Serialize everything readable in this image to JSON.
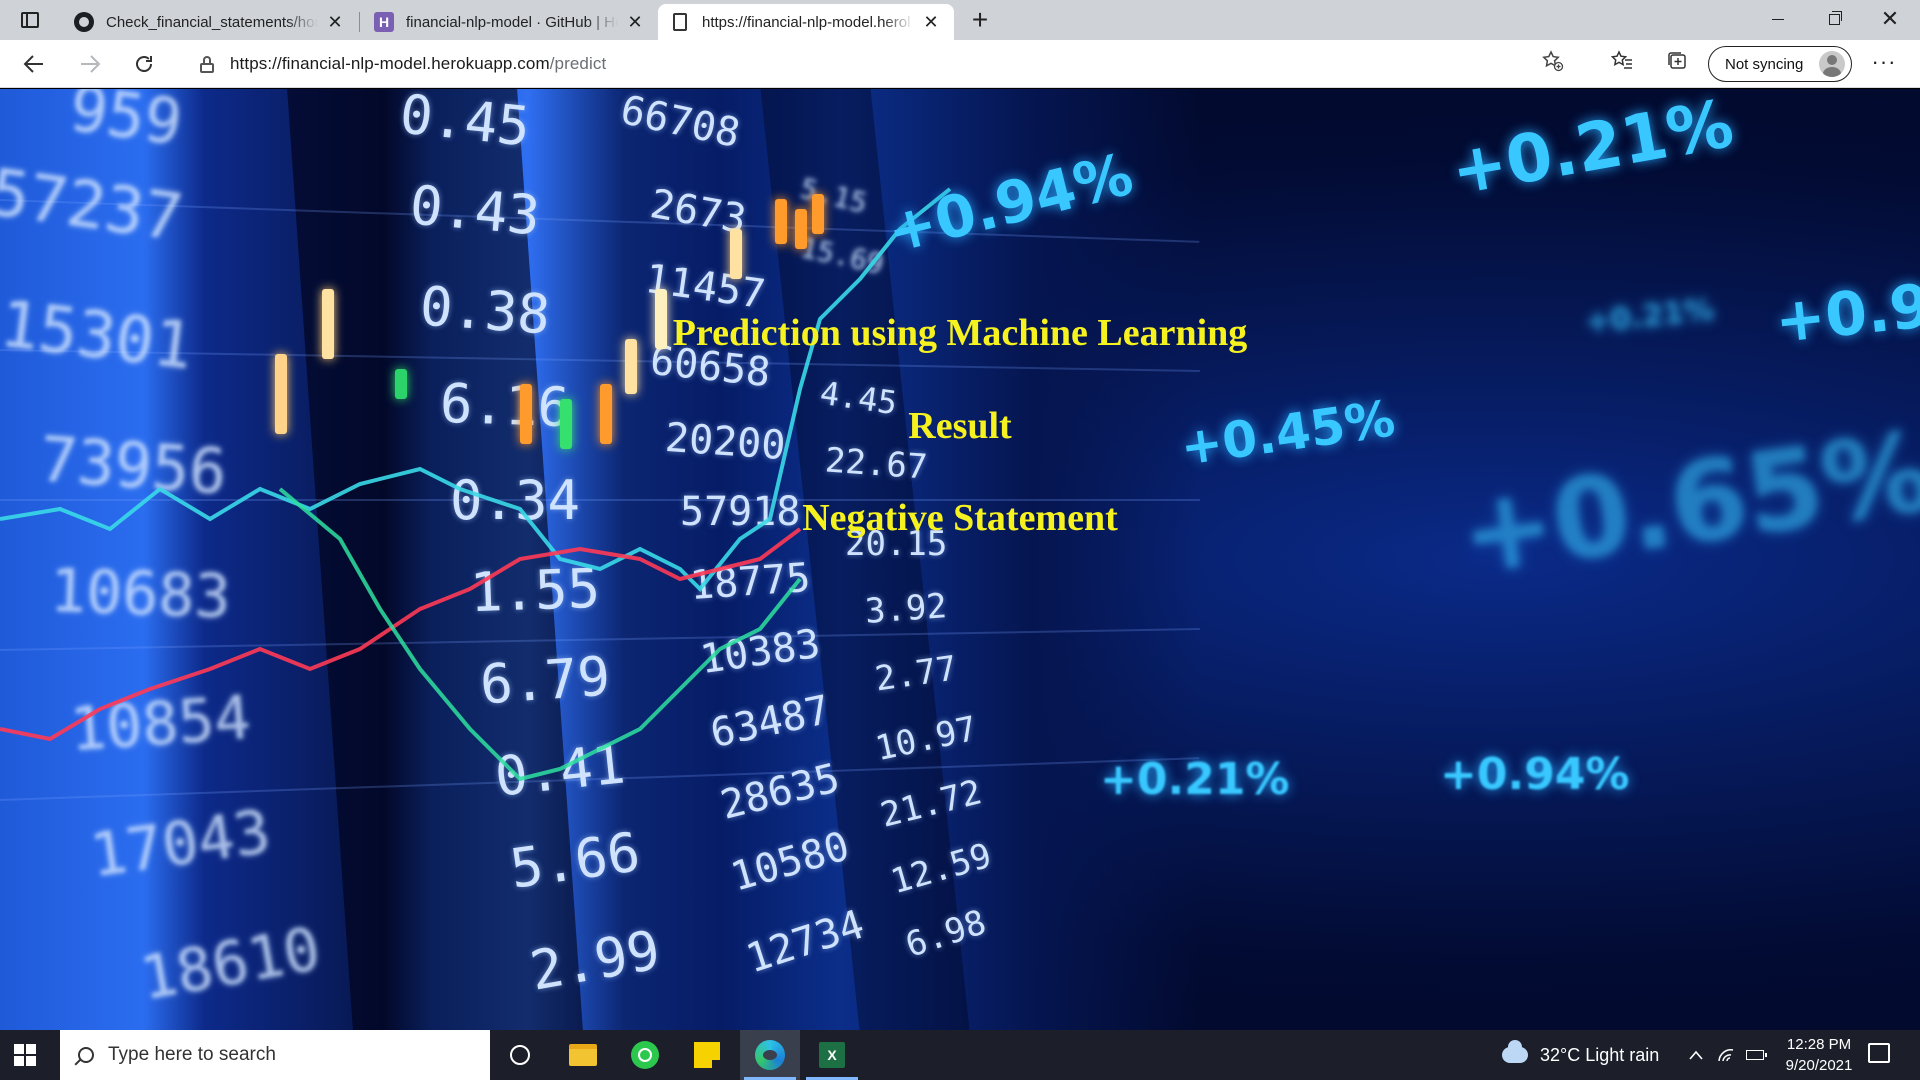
{
  "browser": {
    "tabs": [
      {
        "title": "Check_financial_statements/hom",
        "icon": "github-icon"
      },
      {
        "title": "financial-nlp-model · GitHub | He",
        "icon": "heroku-icon"
      },
      {
        "title": "https://financial-nlp-model.herol",
        "icon": "page-icon",
        "active": true
      }
    ],
    "new_tab": "+",
    "close_glyph": "✕",
    "address": {
      "host": "https://financial-nlp-model.herokuapp.com",
      "path": "/predict"
    },
    "sync_label": "Not syncing",
    "more_glyph": "···"
  },
  "page": {
    "title": "Prediction using Machine Learning",
    "result_label": "Result",
    "result_value": "Negative Statement",
    "text_color": "#f6f220",
    "background": {
      "board_numbers": [
        "959",
        "57237",
        "15301",
        "73956",
        "10683",
        "10854",
        "17043",
        "18610",
        "0.45",
        "0.43",
        "0.38",
        "6.16",
        "0.34",
        "1.55",
        "6.79",
        "0.41",
        "5.66",
        "2.99",
        "66708",
        "2673",
        "11457",
        "60658",
        "20200",
        "57918",
        "18775",
        "10383",
        "63487",
        "28635",
        "10580",
        "12734",
        "5.15",
        "15.69",
        "4.45",
        "22.67",
        "20.15",
        "3.92",
        "2.77",
        "10.97",
        "21.72",
        "12.59",
        "6.98"
      ],
      "percent_labels": [
        "+0.21%",
        "+0.94%",
        "+0.21%",
        "+0.9",
        "+0.45%",
        "+0.65%",
        "+0.21%",
        "+0.94%"
      ]
    }
  },
  "taskbar": {
    "search_placeholder": "Type here to search",
    "weather": "32°C  Light rain",
    "time": "12:28 PM",
    "date": "9/20/2021"
  }
}
